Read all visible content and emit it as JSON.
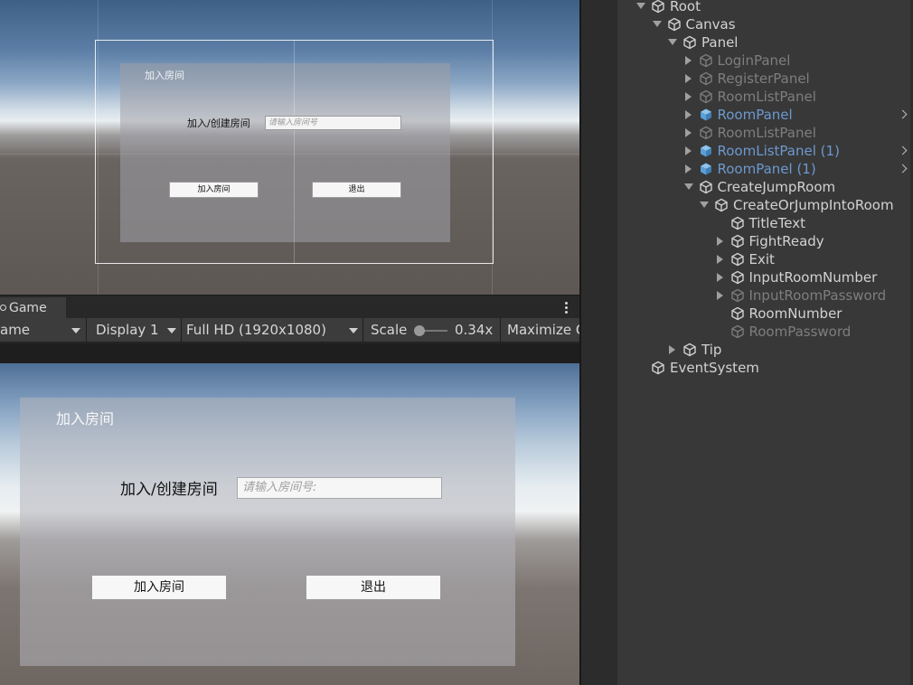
{
  "scene": {
    "title_text": "加入房间",
    "label_text": "加入/创建房间",
    "input_placeholder": "请输入房间号",
    "join_button": "加入房间",
    "exit_button": "退出"
  },
  "game_tab": {
    "label": "Game"
  },
  "game_toolbar": {
    "mode_fragment": "ame",
    "display": "Display 1",
    "resolution": "Full HD (1920x1080)",
    "scale_label": "Scale",
    "scale_value": "0.34x",
    "maximize_fragment": "Maximize O"
  },
  "game": {
    "title_text": "加入房间",
    "label_text": "加入/创建房间",
    "input_placeholder": "请输入房间号:",
    "join_button": "加入房间",
    "exit_button": "退出"
  },
  "hierarchy": {
    "items": [
      {
        "name": "Root",
        "expanded": true,
        "state": "active",
        "icon": "cube-icon"
      },
      {
        "name": "Canvas",
        "expanded": true,
        "state": "active",
        "icon": "cube-icon"
      },
      {
        "name": "Panel",
        "expanded": true,
        "state": "active",
        "icon": "cube-icon"
      },
      {
        "name": "LoginPanel",
        "expanded": false,
        "state": "inactive",
        "icon": "cube-icon"
      },
      {
        "name": "RegisterPanel",
        "expanded": false,
        "state": "inactive",
        "icon": "cube-icon"
      },
      {
        "name": "RoomListPanel",
        "expanded": false,
        "state": "inactive",
        "icon": "cube-icon"
      },
      {
        "name": "RoomPanel",
        "expanded": false,
        "state": "prefab",
        "icon": "prefab-cube-icon",
        "has_chevron": true
      },
      {
        "name": "RoomListPanel",
        "expanded": false,
        "state": "inactive",
        "icon": "cube-icon"
      },
      {
        "name": "RoomListPanel (1)",
        "expanded": false,
        "state": "prefab",
        "icon": "prefab-cube-icon",
        "has_chevron": true
      },
      {
        "name": "RoomPanel (1)",
        "expanded": false,
        "state": "prefab",
        "icon": "prefab-cube-icon",
        "has_chevron": true
      },
      {
        "name": "CreateJumpRoom",
        "expanded": true,
        "state": "active",
        "icon": "cube-icon"
      },
      {
        "name": "CreateOrJumpIntoRoom",
        "expanded": true,
        "state": "active",
        "icon": "cube-icon"
      },
      {
        "name": "TitleText",
        "state": "active",
        "icon": "cube-icon"
      },
      {
        "name": "FightReady",
        "expanded": false,
        "state": "active",
        "icon": "cube-icon"
      },
      {
        "name": "Exit",
        "expanded": false,
        "state": "active",
        "icon": "cube-icon"
      },
      {
        "name": "InputRoomNumber",
        "expanded": false,
        "state": "active",
        "icon": "cube-icon"
      },
      {
        "name": "InputRoomPassword",
        "expanded": false,
        "state": "inactive",
        "icon": "cube-icon"
      },
      {
        "name": "RoomNumber",
        "state": "active",
        "icon": "cube-icon"
      },
      {
        "name": "RoomPassword",
        "state": "inactive",
        "icon": "cube-icon"
      },
      {
        "name": "Tip",
        "expanded": false,
        "state": "active",
        "icon": "cube-icon"
      },
      {
        "name": "EventSystem",
        "state": "active",
        "icon": "cube-icon"
      }
    ]
  },
  "colors": {
    "editor_bg": "#383838",
    "inactive_text": "#7e7e7e",
    "prefab_text": "#6c99cf",
    "prefab_icon": "#5c9fd6",
    "active_text": "#d2d2d2"
  }
}
